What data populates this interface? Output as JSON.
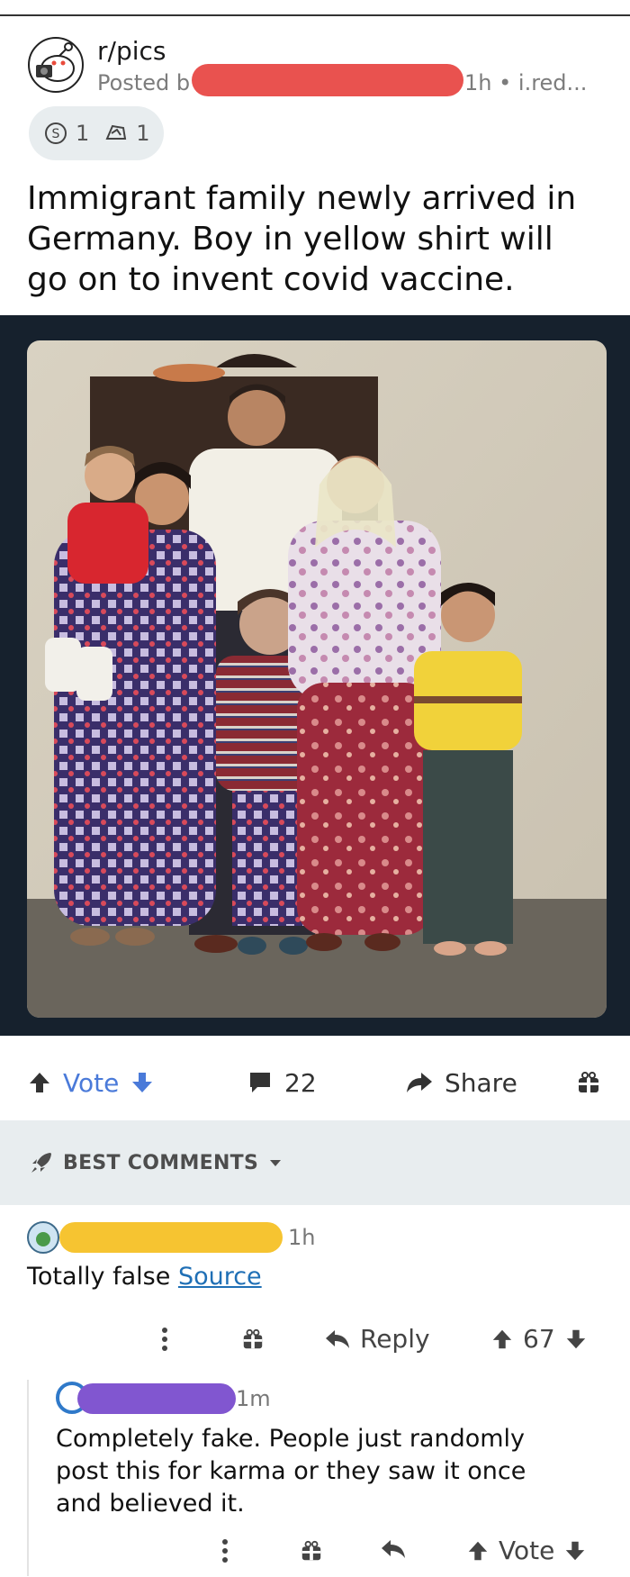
{
  "post": {
    "subreddit": "r/pics",
    "posted_by_prefix": "Posted b",
    "meta": "1h • i.red...",
    "awards": [
      {
        "icon": "silver-award-icon",
        "count": "1"
      },
      {
        "icon": "helpful-award-icon",
        "count": "1"
      }
    ],
    "title": "Immigrant family newly arrived in Germany. Boy in yellow shirt will go on to invent covid vaccine."
  },
  "actions": {
    "vote_label": "Vote",
    "comments_count": "22",
    "share_label": "Share"
  },
  "comments_header": {
    "label": "BEST COMMENTS"
  },
  "comments": [
    {
      "time": "1h",
      "text": "Totally false ",
      "link_text": "Source",
      "reply_label": "Reply",
      "score": "67"
    },
    {
      "time": "1m",
      "text": "Completely fake. People just randomly post this for karma or they saw it once and believed it.",
      "vote_label": "Vote"
    }
  ],
  "colors": {
    "accent_blue": "#4a7ad9",
    "redaction_red": "#e9524f",
    "redaction_yellow": "#f6c431",
    "redaction_purple": "#8156d0",
    "bar_bg": "#e8edef",
    "photo_frame": "#16212d"
  }
}
